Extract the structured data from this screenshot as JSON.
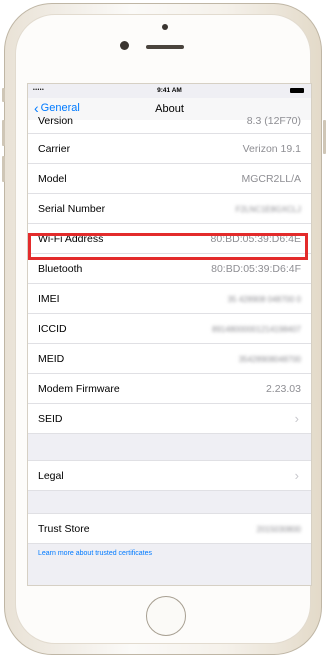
{
  "status_bar": {
    "signal": "•••••",
    "time": "9:41 AM"
  },
  "nav": {
    "back_label": "General",
    "title": "About"
  },
  "rows": [
    {
      "label": "Version",
      "value": "8.3 (12F70)"
    },
    {
      "label": "Carrier",
      "value": "Verizon 19.1"
    },
    {
      "label": "Model",
      "value": "MGCR2LL/A"
    },
    {
      "label": "Serial Number",
      "value": "F2LNC1E8GXCLJ"
    },
    {
      "label": "Wi-Fi Address",
      "value": "80:BD:05:39:D6:4E"
    },
    {
      "label": "Bluetooth",
      "value": "80:BD:05:39:D6:4F"
    },
    {
      "label": "IMEI",
      "value": "35 428908 048700 0"
    },
    {
      "label": "ICCID",
      "value": "89148000001214198407"
    },
    {
      "label": "MEID",
      "value": "35428908048700"
    },
    {
      "label": "Modem Firmware",
      "value": "2.23.03"
    },
    {
      "label": "SEID",
      "value": ""
    }
  ],
  "legal": {
    "label": "Legal"
  },
  "trust": {
    "label": "Trust Store",
    "value": "2015030800"
  },
  "footnote": "Learn more about trusted certificates",
  "highlight_color": "#e32b2b",
  "accent_color": "#007aff"
}
